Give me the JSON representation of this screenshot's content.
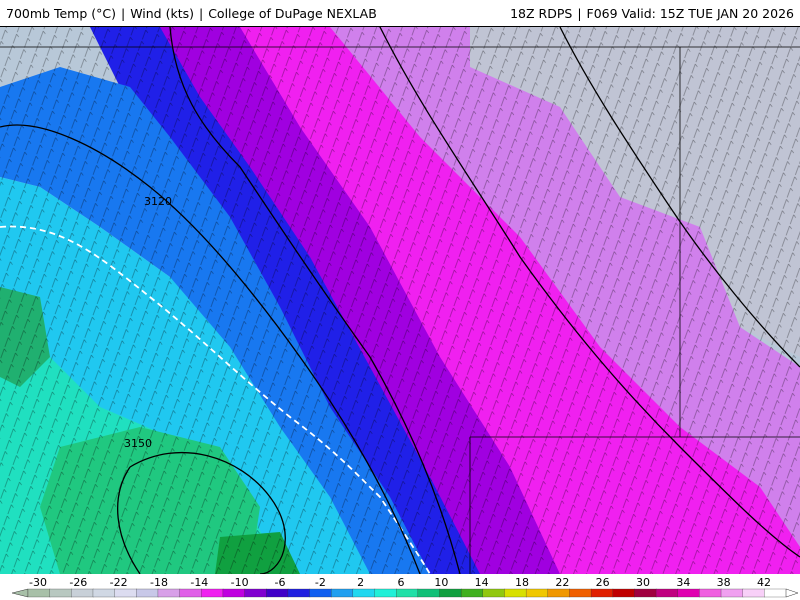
{
  "header": {
    "product": "700mb Temp (°C)",
    "wind": "Wind (kts)",
    "source": "College of DuPage NEXLAB",
    "model_run": "18Z RDPS",
    "forecast_valid": "F069 Valid: 15Z TUE JAN 20 2026"
  },
  "map": {
    "height_contours": [
      "3120",
      "3150"
    ]
  },
  "colorbar": {
    "unit": "°C",
    "tick_labels": [
      "-30",
      "-26",
      "-22",
      "-18",
      "-14",
      "-10",
      "-6",
      "-2",
      "2",
      "6",
      "10",
      "14",
      "18",
      "22",
      "26",
      "30",
      "34",
      "38",
      "42"
    ],
    "colors": [
      "#a8c0a8",
      "#b8c8c0",
      "#c8d0d8",
      "#d0d8e4",
      "#dcdcf0",
      "#c8c8e8",
      "#d8a0e8",
      "#e060e8",
      "#f020f0",
      "#c000e0",
      "#8000d0",
      "#4000c8",
      "#2020e0",
      "#1060f0",
      "#20a0f0",
      "#20d8f0",
      "#20f0d8",
      "#20e0a8",
      "#10c078",
      "#10a040",
      "#40b020",
      "#90c810",
      "#d8e000",
      "#f0c800",
      "#f09800",
      "#f06000",
      "#e02000",
      "#c00000",
      "#a00040",
      "#c00080",
      "#e000b0",
      "#f060e0",
      "#f0a0f0",
      "#f8d0f8",
      "#ffffff"
    ]
  }
}
